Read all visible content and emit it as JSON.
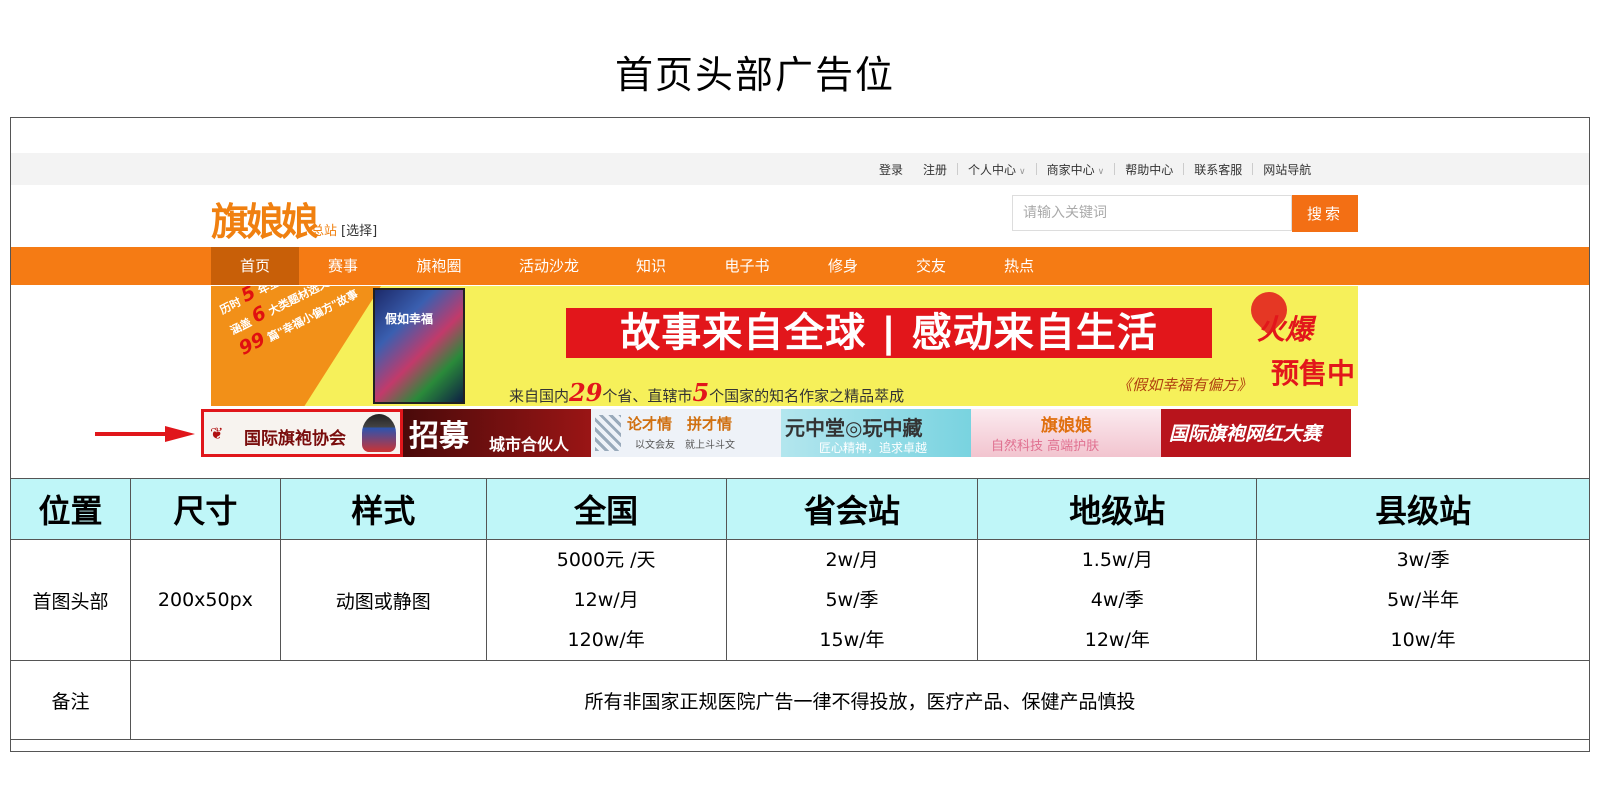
{
  "page_title": "首页头部广告位",
  "site": {
    "top_links": [
      {
        "label": "登录",
        "has_dropdown": false
      },
      {
        "label": "注册",
        "has_dropdown": false
      },
      {
        "label": "个人中心",
        "has_dropdown": true
      },
      {
        "label": "商家中心",
        "has_dropdown": true
      },
      {
        "label": "帮助中心",
        "has_dropdown": false
      },
      {
        "label": "联系客服",
        "has_dropdown": false
      },
      {
        "label": "网站导航",
        "has_dropdown": false
      }
    ],
    "logo": "旗娘娘",
    "station": "总站",
    "select": "[选择]",
    "search_placeholder": "请输入关键词",
    "search_button": "搜索",
    "nav": [
      "首页",
      "赛事",
      "旗袍圈",
      "活动沙龙",
      "知识",
      "电子书",
      "修身",
      "交友",
      "热点"
    ],
    "banner": {
      "left_lines": [
        {
          "pre": "历时",
          "num": "5",
          "post": "年全球精选"
        },
        {
          "pre": "涵盖",
          "num": "6",
          "post": "大类题材选文"
        },
        {
          "pre": "",
          "num": "99",
          "post": "篇\"幸福小偏方\"故事"
        }
      ],
      "book_cover_title": "假如幸福",
      "headline": "故事来自全球 | 感动来自生活",
      "sub_pre": "来自国内",
      "sub_num1": "29",
      "sub_mid": "个省、直辖市",
      "sub_num2": "5",
      "sub_post": "个国家的知名作家之精品萃成",
      "book_title": "《假如幸福有偏方》",
      "hot_top": "火爆",
      "hot_bottom": "预售中"
    },
    "ads": {
      "ad1": "国际旗袍协会",
      "ad2_big": "招募",
      "ad2_small": "城市合伙人",
      "ad3_top": "论才情　拼才情",
      "ad3_bottom": "以文会友　就上斗斗文",
      "ad4_top": "元中堂◎玩中藏",
      "ad4_bottom": "匠心精神，追求卓越",
      "ad5_top": "旗娘娘",
      "ad5_bottom": "自然科技 高端护肤",
      "ad6": "国际旗袍网红大赛"
    }
  },
  "colors": {
    "brand_orange": "#f57b14",
    "nav_active": "#c85f08",
    "banner_yellow": "#f6f05a",
    "headline_red": "#e2161b",
    "header_cyan": "#bff6f8",
    "arrow_red": "#e0161b"
  },
  "table": {
    "headers": [
      "位置",
      "尺寸",
      "样式",
      "全国",
      "省会站",
      "地级站",
      "县级站"
    ],
    "row": {
      "position": "首图头部",
      "size": "200x50px",
      "style": "动图或静图",
      "national": [
        "5000元 /天",
        "12w/月",
        "120w/年"
      ],
      "provincial": [
        "2w/月",
        "5w/季",
        "15w/年"
      ],
      "prefecture": [
        "1.5w/月",
        "4w/季",
        "12w/年"
      ],
      "county": [
        "3w/季",
        "5w/半年",
        "10w/年"
      ]
    },
    "note_label": "备注",
    "note_text": "所有非国家正规医院广告一律不得投放，医疗产品、保健产品慎投"
  }
}
